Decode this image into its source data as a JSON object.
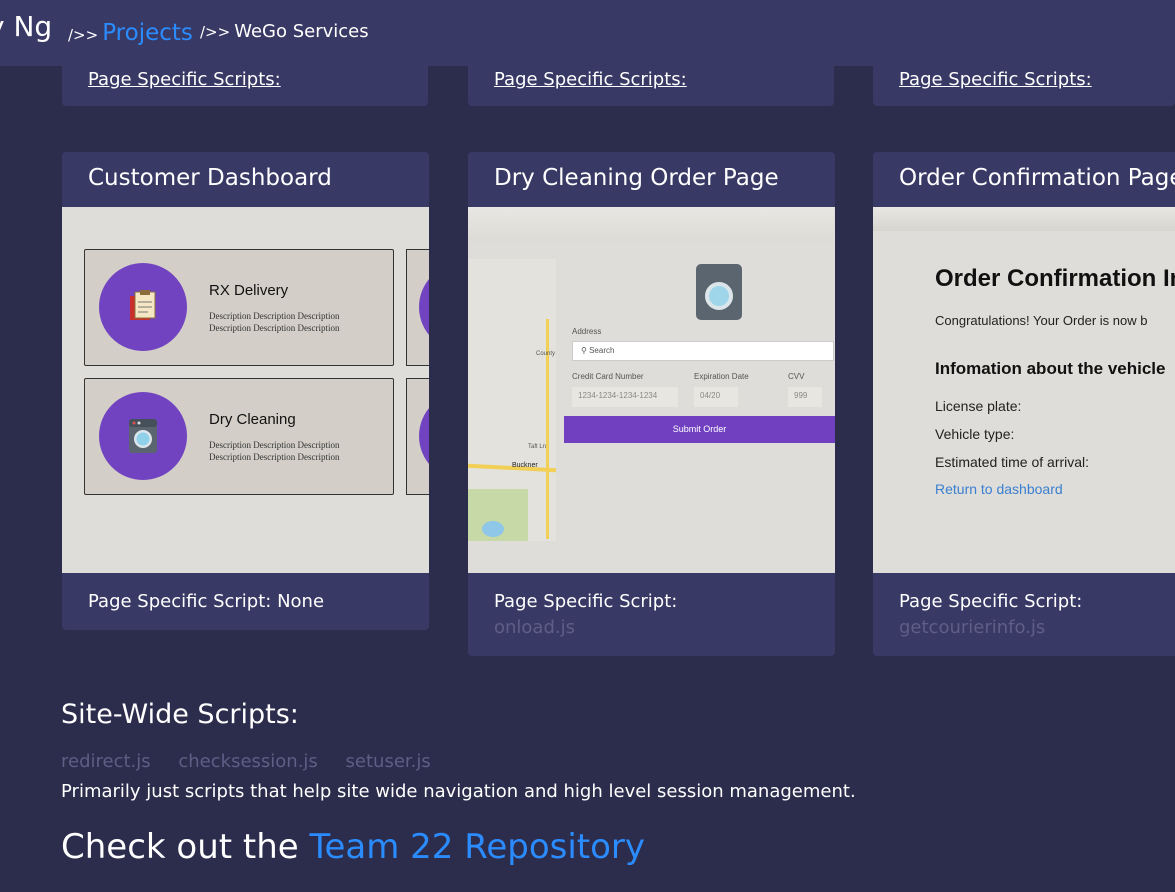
{
  "header": {
    "brand": "y Ng",
    "separator": "/>>",
    "crumb_projects": "Projects",
    "crumb_current": "WeGo Services"
  },
  "top_cards": [
    {
      "label": "Page Specific Scripts:"
    },
    {
      "label": "Page Specific Scripts:"
    },
    {
      "label": "Page Specific Scripts:"
    }
  ],
  "cards": [
    {
      "title": "Customer Dashboard",
      "footer": "Page Specific Script: None",
      "file": ""
    },
    {
      "title": "Dry Cleaning Order Page",
      "footer": "Page Specific Script:",
      "file": "onload.js"
    },
    {
      "title": "Order Confirmation Page",
      "footer": "Page Specific Script:",
      "file": "getcourierinfo.js"
    }
  ],
  "dashboard_mock": {
    "services": [
      {
        "name": "RX Delivery",
        "desc": "Description Description Description Description Description Description",
        "icon": "clipboard-icon"
      },
      {
        "name": "Dry Cleaning",
        "desc": "Description Description Description Description Description Description",
        "icon": "washer-icon"
      }
    ]
  },
  "order_mock": {
    "address_label": "Address",
    "search_placeholder": "Search",
    "cc_label": "Credit Card Number",
    "cc_value": "1234-1234-1234-1234",
    "exp_label": "Expiration Date",
    "exp_value": "04/20",
    "cvv_label": "CVV",
    "cvv_value": "999",
    "submit_label": "Submit Order",
    "map_labels": [
      "County",
      "Buckner",
      "Taft Ln"
    ]
  },
  "confirm_mock": {
    "title": "Order Confirmation In",
    "congrats": "Congratulations! Your Order is now b",
    "info_heading": "Infomation about the vehicle",
    "license": "License plate:",
    "vehicle": "Vehicle type:",
    "eta": "Estimated time of arrival:",
    "return_link": "Return to dashboard"
  },
  "site_wide": {
    "title": "Site-Wide Scripts:",
    "scripts": [
      "redirect.js",
      "checksession.js",
      "setuser.js"
    ],
    "description": "Primarily just scripts that help site wide navigation and high level session management."
  },
  "repo": {
    "prefix": "Check out the ",
    "link": "Team 22 Repository"
  },
  "colors": {
    "background": "#2c2c4c",
    "card": "#393966",
    "link": "#2b8cff",
    "muted": "#5e5e86",
    "purple": "#7243c0"
  }
}
